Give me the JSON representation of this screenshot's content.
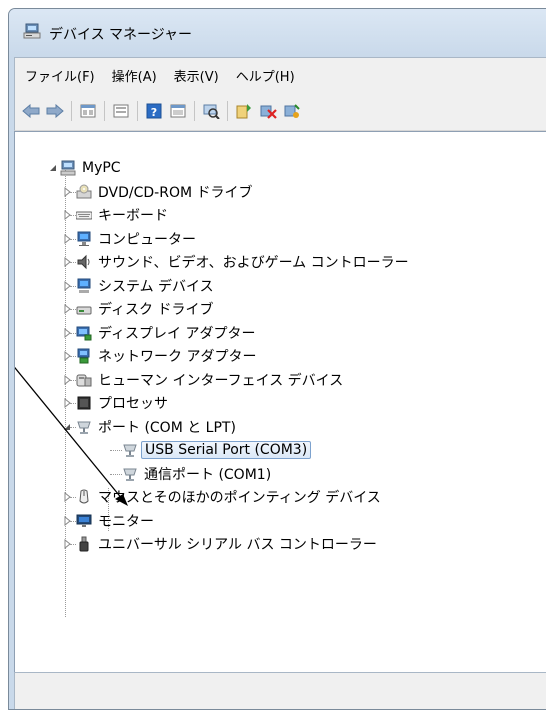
{
  "window": {
    "title": "デバイス マネージャー",
    "icon": "device-manager-icon"
  },
  "menu": [
    "ファイル(F)",
    "操作(A)",
    "表示(V)",
    "ヘルプ(H)"
  ],
  "toolbar": [
    "back-icon",
    "forward-icon",
    "|",
    "properties-icon",
    "|",
    "show-hide-icon",
    "|",
    "help-icon",
    "view-icon",
    "|",
    "scan-hardware-icon",
    "|",
    "update-driver-icon",
    "disable-device-icon",
    "uninstall-icon"
  ],
  "tree": {
    "root": "MyPC",
    "items": [
      {
        "label": "DVD/CD-ROM ドライブ",
        "icon": "dvd-drive-icon"
      },
      {
        "label": "キーボード",
        "icon": "keyboard-icon"
      },
      {
        "label": "コンピューター",
        "icon": "computer-icon"
      },
      {
        "label": "サウンド、ビデオ、およびゲーム コントローラー",
        "icon": "speaker-icon"
      },
      {
        "label": "システム デバイス",
        "icon": "system-device-icon"
      },
      {
        "label": "ディスク ドライブ",
        "icon": "disk-drive-icon"
      },
      {
        "label": "ディスプレイ アダプター",
        "icon": "display-adapter-icon"
      },
      {
        "label": "ネットワーク アダプター",
        "icon": "network-adapter-icon"
      },
      {
        "label": "ヒューマン インターフェイス デバイス",
        "icon": "hid-icon"
      },
      {
        "label": "プロセッサ",
        "icon": "processor-icon"
      },
      {
        "label": "ポート (COM と LPT)",
        "icon": "port-icon",
        "expanded": true,
        "children": [
          {
            "label": "USB Serial Port (COM3)",
            "icon": "port-icon",
            "selected": true
          },
          {
            "label": "通信ポート (COM1)",
            "icon": "port-icon"
          }
        ]
      },
      {
        "label": "マウスとそのほかのポインティング デバイス",
        "icon": "mouse-icon"
      },
      {
        "label": "モニター",
        "icon": "monitor-icon"
      },
      {
        "label": "ユニバーサル シリアル バス コントローラー",
        "icon": "usb-icon"
      }
    ]
  }
}
